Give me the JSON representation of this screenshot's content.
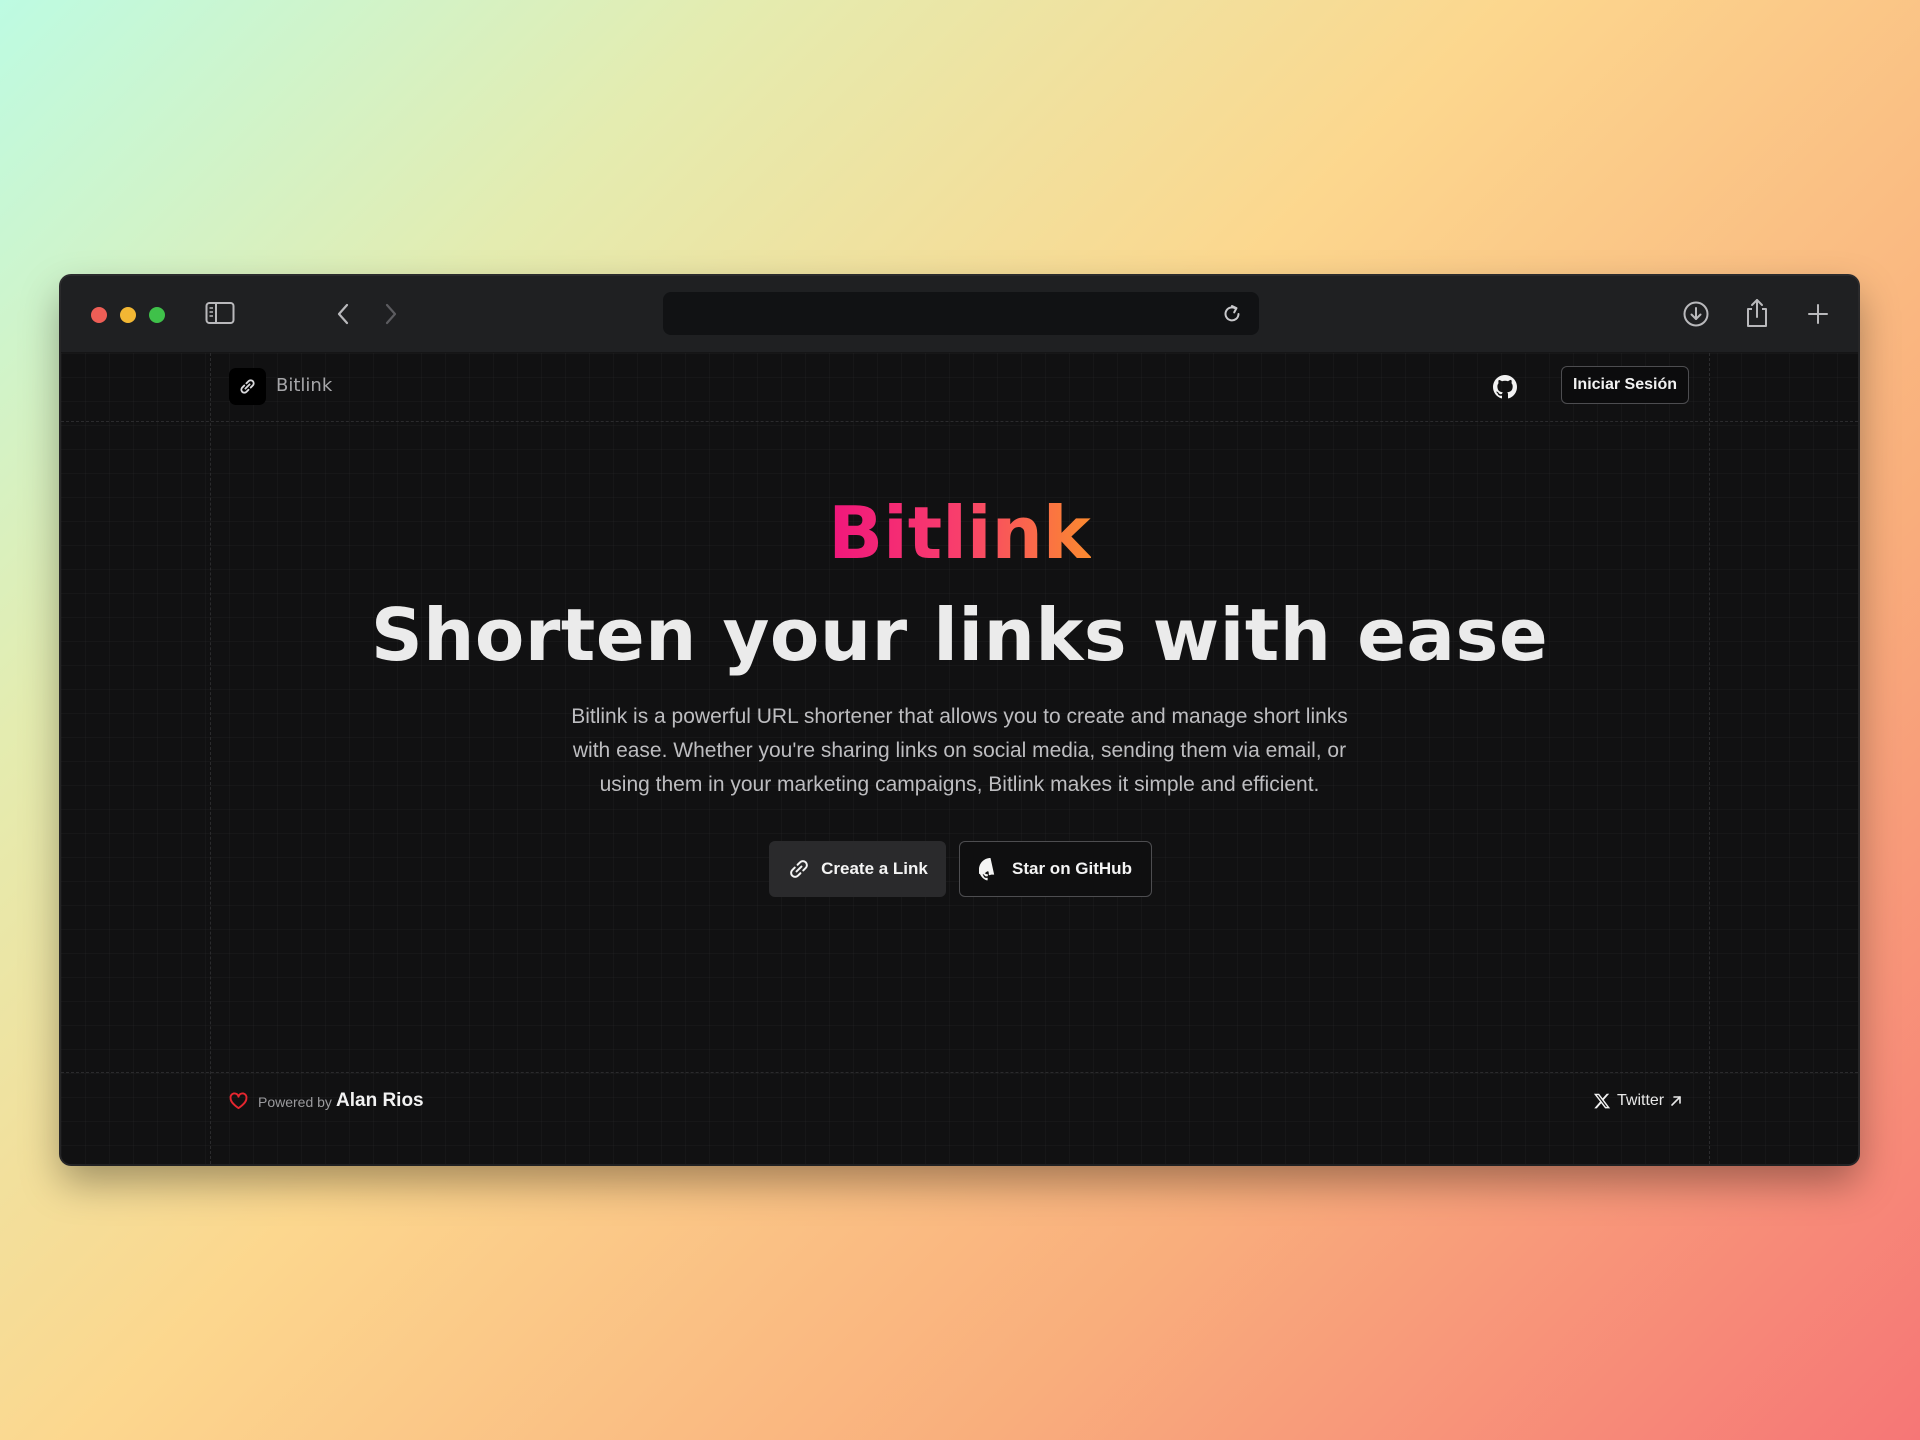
{
  "browser": {
    "address_bar": {
      "value": "",
      "placeholder": ""
    },
    "icons": [
      "sidebar-icon",
      "back-icon",
      "forward-icon",
      "shield-icon",
      "reload-icon",
      "download-icon",
      "share-icon",
      "new-tab-icon",
      "tabs-overview-icon"
    ]
  },
  "navbar": {
    "brand": "Bitlink",
    "login_label": "Iniciar Sesión",
    "icons": [
      "link-icon",
      "github-icon"
    ]
  },
  "hero": {
    "brand": "Bitlink",
    "title": "Shorten your links with ease",
    "description": "Bitlink is a powerful URL shortener that allows you to create and manage short links with ease. Whether you're sharing links on social media, sending them via email, or using them in your marketing campaigns, Bitlink makes it simple and efficient.",
    "primary_button": "Create a Link",
    "secondary_button": "Star on GitHub",
    "brand_gradient": [
      "#f0167c",
      "#fb8a2f"
    ]
  },
  "footer": {
    "powered_by_label": "Powered by",
    "author": "Alan Rios",
    "twitter_label": "Twitter",
    "heart_color": "#e5262f"
  }
}
